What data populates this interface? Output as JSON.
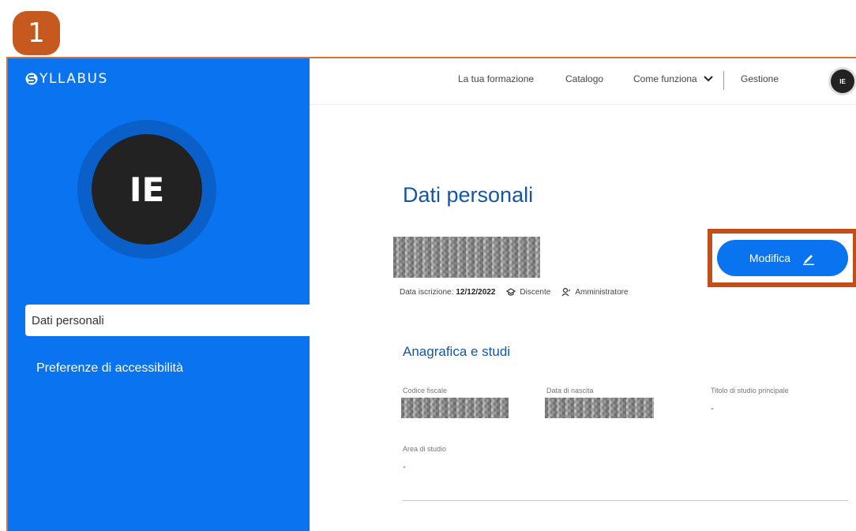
{
  "step": "1",
  "app": {
    "logo": "YLLABUS"
  },
  "header": {
    "nav": [
      "La tua formazione",
      "Catalogo",
      "Come funziona"
    ],
    "gestione": "Gestione",
    "user_initials": "IE"
  },
  "sidebar": {
    "avatar_initials": "IE",
    "items": [
      {
        "label": "Dati personali",
        "active": true
      },
      {
        "label": "Preferenze di accessibilità",
        "active": false
      }
    ]
  },
  "main": {
    "title": "Dati personali",
    "subscription_label": "Data iscrizione:",
    "subscription_date": "12/12/2022",
    "roles": [
      "Discente",
      "Amministratore"
    ],
    "edit_button": "Modifica",
    "section_title": "Anagrafica e studi",
    "fields": [
      {
        "label": "Codice fiscale",
        "value": ""
      },
      {
        "label": "Data di nascita",
        "value": ""
      },
      {
        "label": "Titolo di studio principale",
        "value": "-"
      },
      {
        "label": "Area di studio",
        "value": "-"
      }
    ]
  },
  "colors": {
    "primary": "#0a74f0",
    "highlight": "#c24f1a",
    "title": "#1456a6"
  }
}
